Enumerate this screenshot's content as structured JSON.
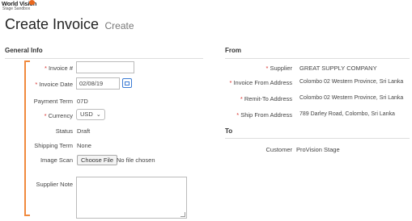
{
  "logo": {
    "line1": "World Vision",
    "line2": "Stage Sandbox"
  },
  "page": {
    "title": "Create Invoice",
    "subtitle": "Create"
  },
  "general": {
    "heading": "General Info",
    "invoice_no_label": "Invoice #",
    "invoice_no_value": "",
    "invoice_date_label": "Invoice Date",
    "invoice_date_value": "02/08/19",
    "payment_term_label": "Payment Term",
    "payment_term_value": "07D",
    "currency_label": "Currency",
    "currency_value": "USD",
    "status_label": "Status",
    "status_value": "Draft",
    "shipping_term_label": "Shipping Term",
    "shipping_term_value": "None",
    "image_scan_label": "Image Scan",
    "choose_file_label": "Choose File",
    "no_file_text": "No file chosen",
    "supplier_note_label": "Supplier Note"
  },
  "from": {
    "heading": "From",
    "supplier_label": "Supplier",
    "supplier_value": "GREAT SUPPLY COMPANY",
    "invoice_from_label": "Invoice From Address",
    "invoice_from_value": "Colombo 02 Western Province, Sri Lanka",
    "remit_to_label": "Remit-To Address",
    "remit_to_value": "Colombo 02 Western Province, Sri Lanka",
    "ship_from_label": "Ship From Address",
    "ship_from_value": "789 Darley Road, Colombo, Sri Lanka"
  },
  "to": {
    "heading": "To",
    "customer_label": "Customer",
    "customer_value": "ProVision Stage"
  },
  "colors": {
    "accent": "#f08a3e",
    "required": "#d9302c",
    "link": "#3b7bd4"
  }
}
